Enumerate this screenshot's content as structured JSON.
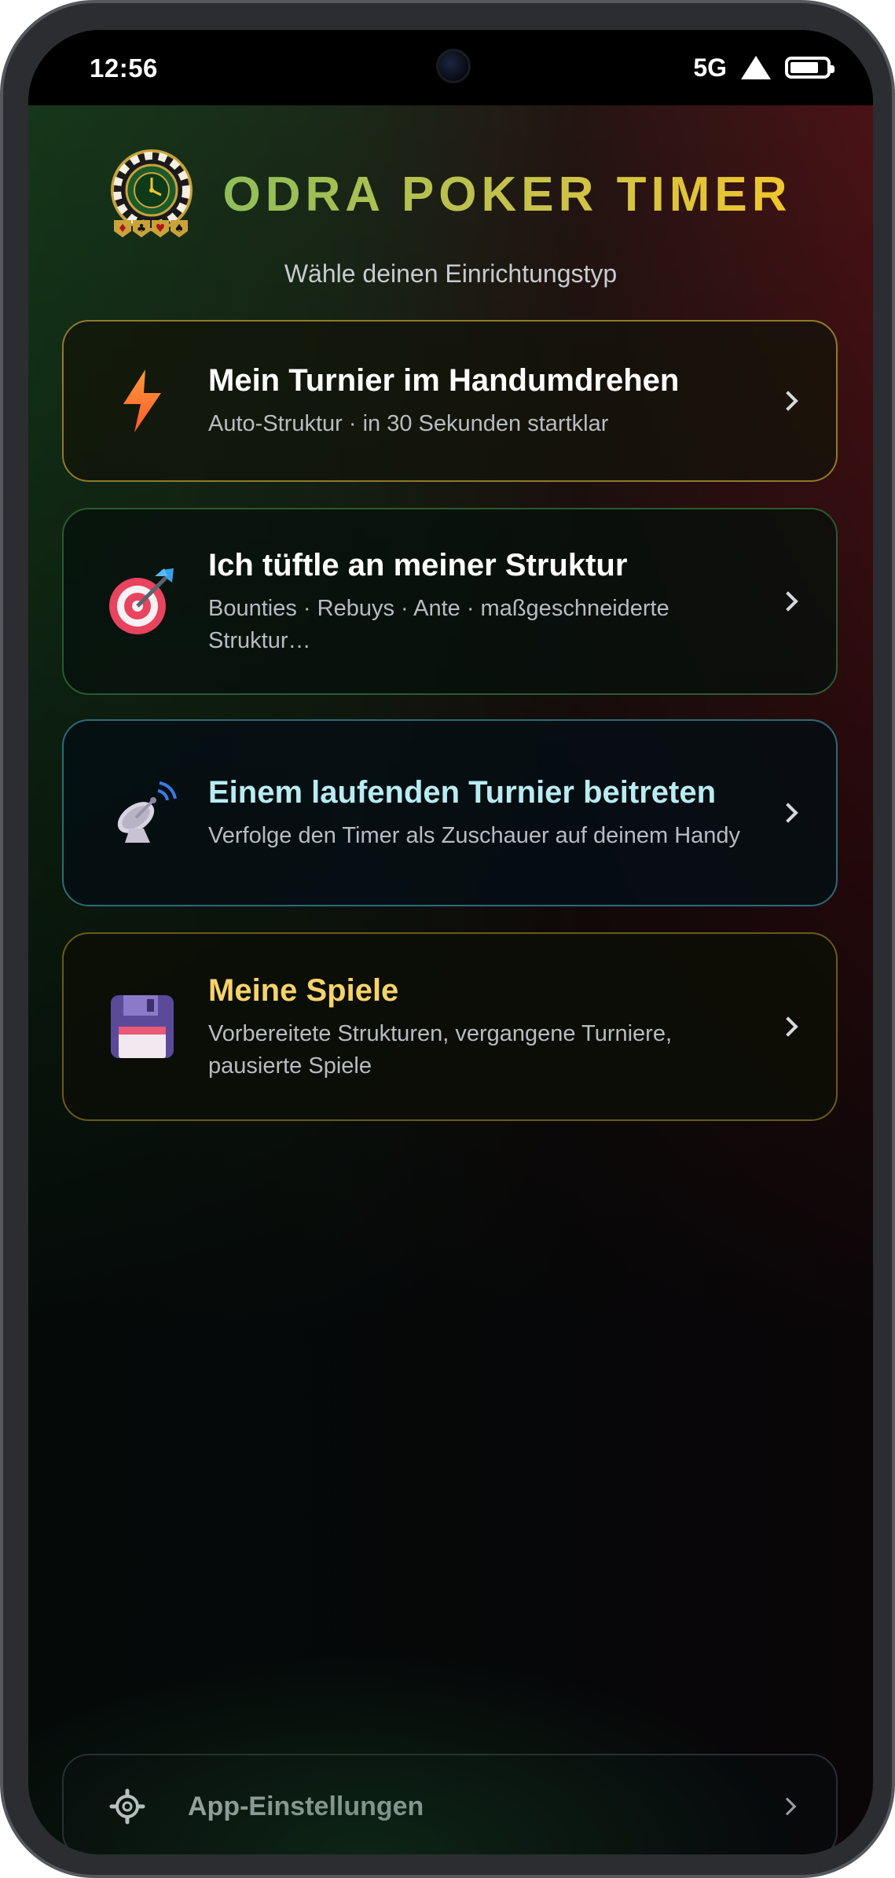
{
  "status_bar": {
    "time": "12:56",
    "network": "5G",
    "icons": [
      "camera-icon",
      "signal-icon",
      "battery-icon"
    ]
  },
  "header": {
    "logo": "poker-chip-logo",
    "title": "ODRA POKER TIMER",
    "subtitle": "Wähle deinen Einrichtungstyp"
  },
  "options": [
    {
      "icon": "lightning-icon",
      "title": "Mein Turnier im Handumdrehen",
      "description": "Auto-Struktur · in 30 Sekunden startklar",
      "accent": "#8f7a2a"
    },
    {
      "icon": "target-icon",
      "title": "Ich tüftle an meiner Struktur",
      "description": "Bounties · Rebuys · Ante · maßgeschneiderte Struktur…",
      "accent": "#2a5a30"
    },
    {
      "icon": "satellite-dish-icon",
      "title": "Einem laufenden Turnier beitreten",
      "description": "Verfolge den Timer als Zuschauer auf deinem Handy",
      "accent": "#2c6a78"
    },
    {
      "icon": "floppy-disk-icon",
      "title": "Meine Spiele",
      "description": "Vorbereitete Strukturen, vergangene Turniere, pausierte Spiele",
      "accent": "#6a5a1a"
    }
  ],
  "footer": {
    "icon": "gear-icon",
    "label": "App-Einstellungen"
  },
  "colors": {
    "title_gradient_start": "#8fbd5a",
    "title_gradient_end": "#f0c62c",
    "join_title": "#b8ecf2",
    "games_title": "#f5d26b"
  }
}
